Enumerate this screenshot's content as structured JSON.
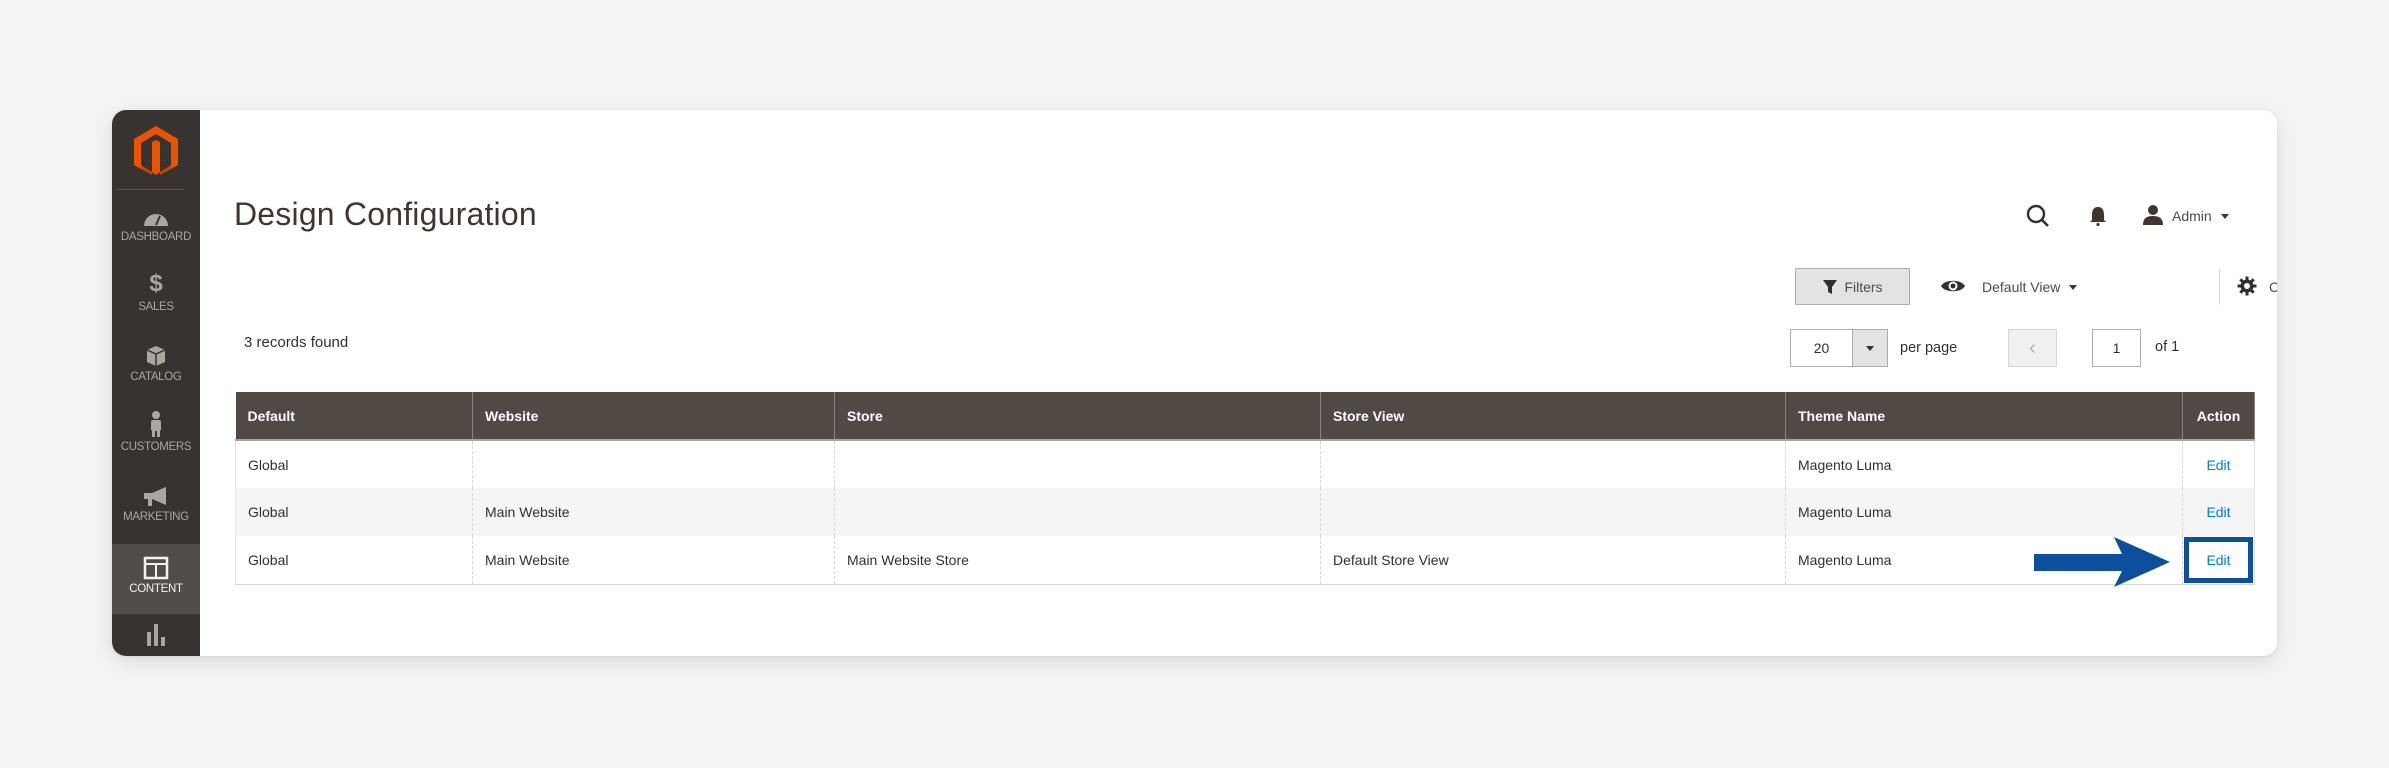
{
  "sidebar": {
    "logo": "magento-logo",
    "items": [
      {
        "label": "Dashboard",
        "icon": "dashboard-gauge-icon",
        "active": false
      },
      {
        "label": "Sales",
        "icon": "dollar-icon",
        "active": false
      },
      {
        "label": "Catalog",
        "icon": "box-icon",
        "active": false
      },
      {
        "label": "Customers",
        "icon": "person-icon",
        "active": false
      },
      {
        "label": "Marketing",
        "icon": "megaphone-icon",
        "active": false
      },
      {
        "label": "Content",
        "icon": "layout-icon",
        "active": true
      },
      {
        "label": "",
        "icon": "bar-chart-icon",
        "active": false
      }
    ]
  },
  "header": {
    "title": "Design Configuration",
    "user_name": "Admin"
  },
  "toolbar": {
    "filters_label": "Filters",
    "view_label": "Default View",
    "columns_label": "Columns",
    "records_found": "3 records found",
    "per_page_value": "20",
    "per_page_label": "per page",
    "page_current": "1",
    "page_of": "of 1",
    "prev_symbol": "‹",
    "next_symbol": "›"
  },
  "table": {
    "columns": [
      "Default",
      "Website",
      "Store",
      "Store View",
      "Theme Name",
      "Action"
    ],
    "rows": [
      {
        "default": "Global",
        "website": "",
        "store": "",
        "store_view": "",
        "theme": "Magento Luma",
        "action": "Edit"
      },
      {
        "default": "Global",
        "website": "Main Website",
        "store": "",
        "store_view": "",
        "theme": "Magento Luma",
        "action": "Edit"
      },
      {
        "default": "Global",
        "website": "Main Website",
        "store": "Main Website Store",
        "store_view": "Default Store View",
        "theme": "Magento Luma",
        "action": "Edit"
      }
    ]
  },
  "annotation": {
    "highlighted_row": 3,
    "color": "#0c4f9c"
  },
  "colors": {
    "sidebar_bg": "#373330",
    "header_bg": "#514943",
    "brand_orange": "#eb5202",
    "link": "#007bdb"
  }
}
